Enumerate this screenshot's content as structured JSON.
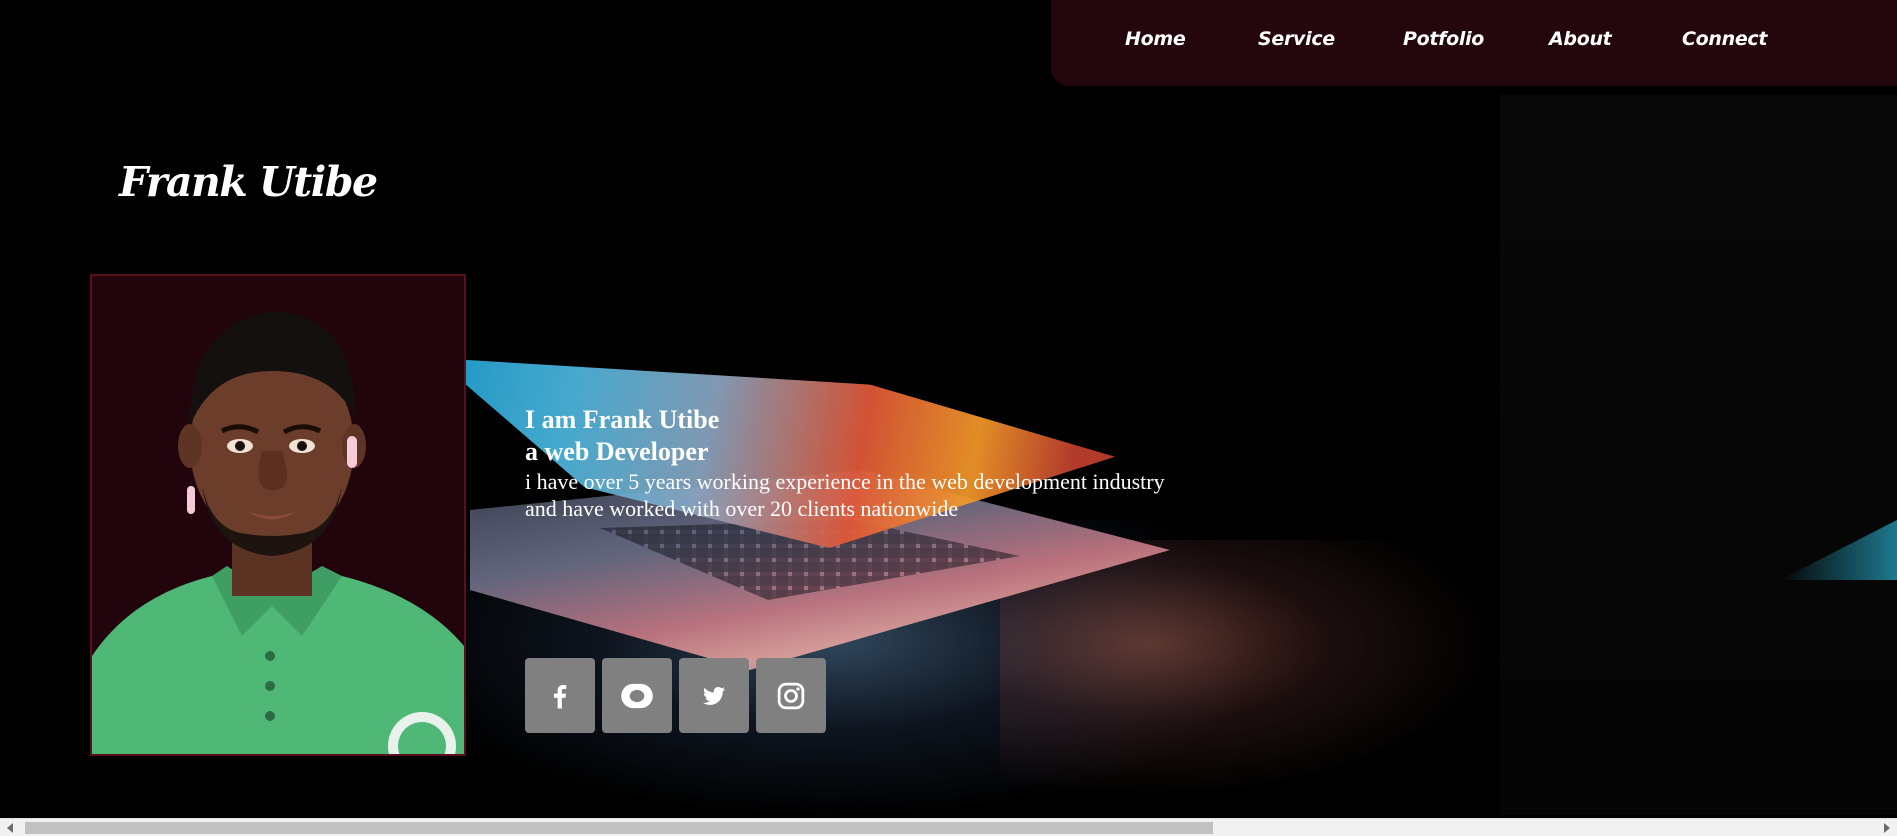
{
  "nav": {
    "items": [
      {
        "label": "Home"
      },
      {
        "label": "Service"
      },
      {
        "label": "Potfolio"
      },
      {
        "label": "About"
      },
      {
        "label": "Connect"
      }
    ]
  },
  "brand": {
    "name": "Frank Utibe"
  },
  "hero": {
    "line1": "I am Frank Utibe",
    "line2": "a web Developer",
    "para1": "i have over 5 years working experience in the web development industry",
    "para2": "and have worked with over 20 clients nationwide"
  },
  "socials": [
    {
      "icon": "facebook-icon"
    },
    {
      "icon": "youtube-icon"
    },
    {
      "icon": "twitter-icon"
    },
    {
      "icon": "instagram-icon"
    }
  ],
  "colors": {
    "nav_bg": "#24060d",
    "photo_border": "#5a0f1d",
    "social_bg": "#808080",
    "text": "#ffffff",
    "page_bg": "#000000"
  }
}
